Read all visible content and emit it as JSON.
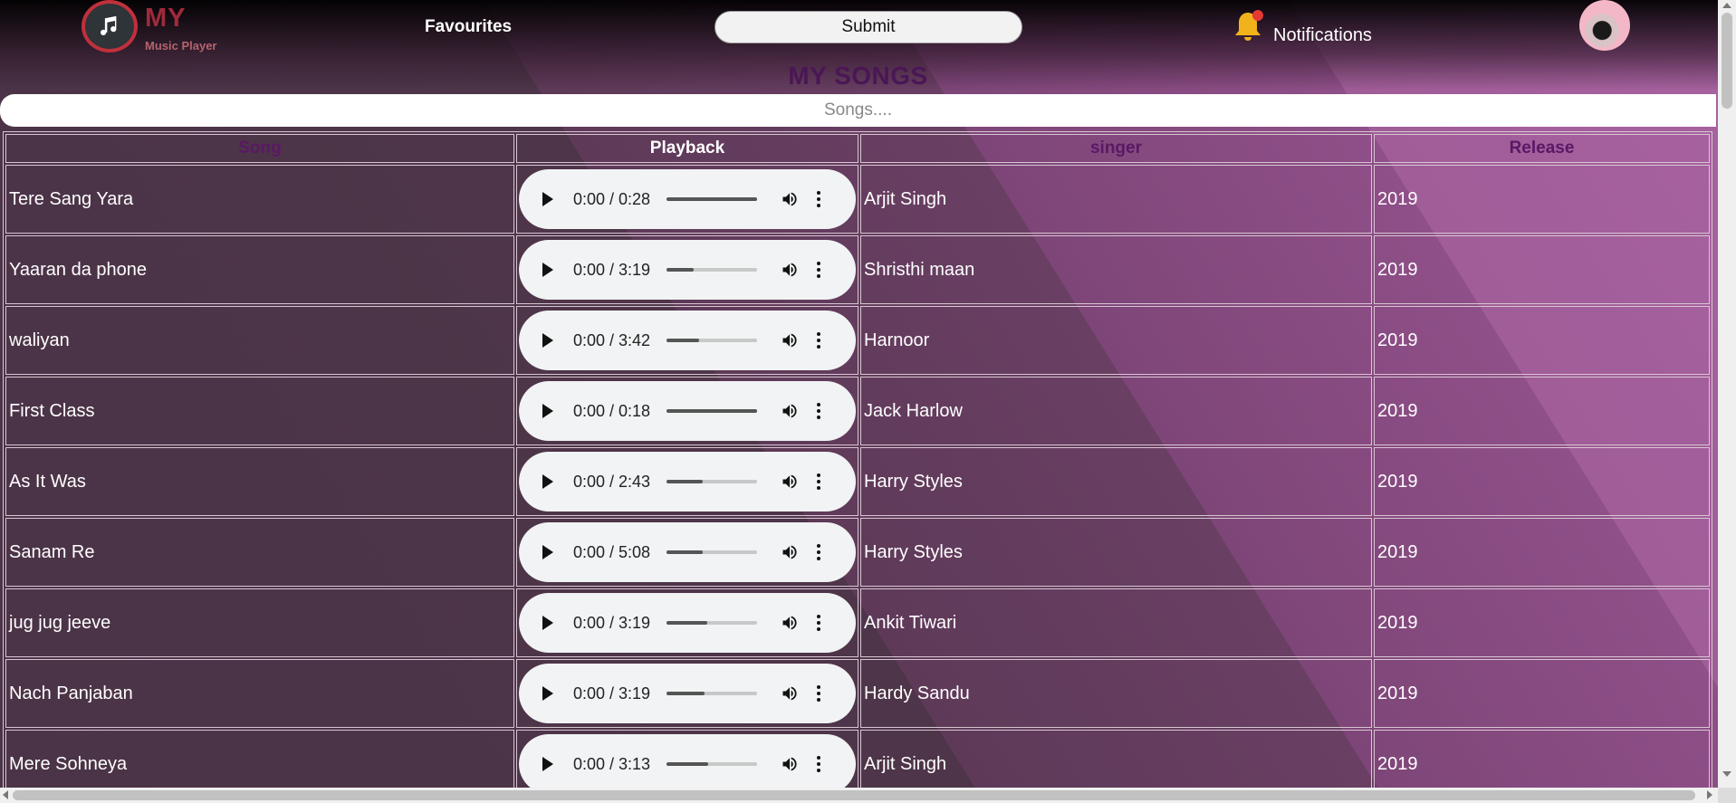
{
  "brand": {
    "title": "MY",
    "subtitle": "Music Player",
    "icon": "music-note-icon"
  },
  "nav": {
    "favourites": "Favourites",
    "submit": "Submit",
    "notifications": "Notifications"
  },
  "page_title": "MY SONGS",
  "search": {
    "placeholder": "Songs...."
  },
  "table": {
    "headers": {
      "song": "Song",
      "playback": "Playback",
      "singer": "singer",
      "release": "Release"
    },
    "rows": [
      {
        "song": "Tere Sang Yara",
        "time": "0:00 / 0:28",
        "singer": "Arjit Singh",
        "release": "2019"
      },
      {
        "song": "Yaaran da phone",
        "time": "0:00 / 3:19",
        "singer": "Shristhi maan",
        "release": "2019"
      },
      {
        "song": "waliyan",
        "time": "0:00 / 3:42",
        "singer": "Harnoor",
        "release": "2019"
      },
      {
        "song": "First Class",
        "time": "0:00 / 0:18",
        "singer": "Jack Harlow",
        "release": "2019"
      },
      {
        "song": "As It Was",
        "time": "0:00 / 2:43",
        "singer": "Harry Styles",
        "release": "2019"
      },
      {
        "song": "Sanam Re",
        "time": "0:00 / 5:08",
        "singer": "Harry Styles",
        "release": "2019"
      },
      {
        "song": "jug jug jeeve",
        "time": "0:00 / 3:19",
        "singer": "Ankit Tiwari",
        "release": "2019"
      },
      {
        "song": "Nach Panjaban",
        "time": "0:00 / 3:19",
        "singer": "Hardy Sandu",
        "release": "2019"
      },
      {
        "song": "Mere Sohneya",
        "time": "0:00 / 3:13",
        "singer": "Arjit Singh",
        "release": "2019"
      }
    ]
  },
  "colors": {
    "accent": "#9e2a3b",
    "title": "#4a1655",
    "header_text": "#5a1865"
  }
}
